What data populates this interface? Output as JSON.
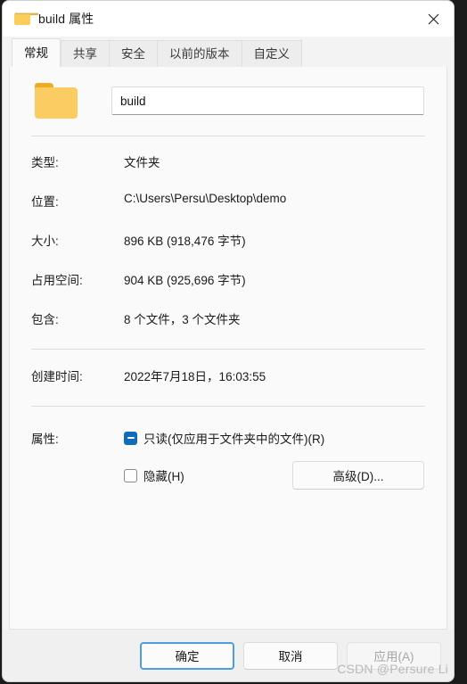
{
  "window": {
    "title": "build 属性",
    "folder_icon": "folder-icon",
    "close_icon": "close-icon"
  },
  "tabs": [
    {
      "label": "常规",
      "active": true
    },
    {
      "label": "共享",
      "active": false
    },
    {
      "label": "安全",
      "active": false
    },
    {
      "label": "以前的版本",
      "active": false
    },
    {
      "label": "自定义",
      "active": false
    }
  ],
  "general": {
    "name_value": "build",
    "name_placeholder": "",
    "properties": [
      {
        "label": "类型:",
        "value": "文件夹"
      },
      {
        "label": "位置:",
        "value": "C:\\Users\\Persu\\Desktop\\demo"
      },
      {
        "label": "大小:",
        "value": "896 KB (918,476 字节)"
      },
      {
        "label": "占用空间:",
        "value": "904 KB (925,696 字节)"
      },
      {
        "label": "包含:",
        "value": "8 个文件，3 个文件夹"
      }
    ],
    "created": {
      "label": "创建时间:",
      "value": "2022年7月18日，16:03:55"
    },
    "attributes": {
      "label": "属性:",
      "readonly": {
        "label": "只读(仅应用于文件夹中的文件)(R)",
        "state": "indeterminate"
      },
      "hidden": {
        "label": "隐藏(H)",
        "state": "unchecked"
      },
      "advanced_button": "高级(D)..."
    }
  },
  "footer": {
    "ok": "确定",
    "cancel": "取消",
    "apply": "应用(A)",
    "apply_disabled": true
  },
  "watermark": "CSDN @Persure Li",
  "colors": {
    "accent": "#0f6cbd",
    "focus_ring": "#4d9ee0",
    "folder": "#fbcc62",
    "window_bg": "#f3f3f3",
    "panel_bg": "#fafafa"
  }
}
